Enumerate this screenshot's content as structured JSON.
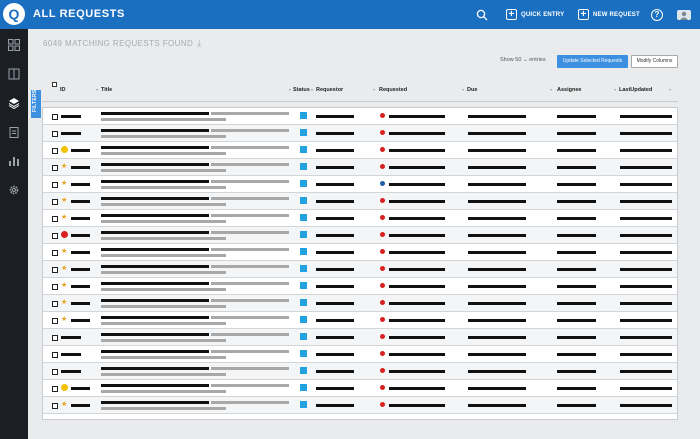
{
  "app": {
    "logo_letter": "Q",
    "title": "ALL REQUESTS"
  },
  "topbar": {
    "quick_entry": "QUICK ENTRY",
    "new_request": "NEW REQUEST"
  },
  "summary": {
    "found": "6049 MATCHING REQUESTS FOUND"
  },
  "controls": {
    "show_label": "Show",
    "show_value": "50",
    "entries_label": "entries",
    "update_button": "Update Selected Requests",
    "modify_button": "Modify Columns"
  },
  "filters_tab": "FILTERS",
  "columns": [
    "ID",
    "Title",
    "Status",
    "Requestor",
    "Requested",
    "Due",
    "Assignee",
    "LastUpdated"
  ],
  "colors": {
    "accent": "#1a6fc0",
    "sidebar": "#1b1f23",
    "status": "#23a2e0",
    "priority_red": "#d92020",
    "priority_yellow": "#f2c200",
    "star": "#e8a020"
  },
  "icons": {
    "search": "search-icon",
    "help": "help-icon",
    "user": "user-avatar-icon"
  },
  "rows": [
    {
      "flag": "none",
      "req_dot": "red"
    },
    {
      "flag": "none",
      "req_dot": "red"
    },
    {
      "flag": "yellow",
      "req_dot": "red"
    },
    {
      "flag": "star",
      "req_dot": "red"
    },
    {
      "flag": "star",
      "req_dot": "blue"
    },
    {
      "flag": "star",
      "req_dot": "red"
    },
    {
      "flag": "star",
      "req_dot": "red"
    },
    {
      "flag": "red",
      "req_dot": "red"
    },
    {
      "flag": "star",
      "req_dot": "red"
    },
    {
      "flag": "star",
      "req_dot": "red"
    },
    {
      "flag": "star",
      "req_dot": "red"
    },
    {
      "flag": "star",
      "req_dot": "red"
    },
    {
      "flag": "star",
      "req_dot": "red"
    },
    {
      "flag": "none",
      "req_dot": "red"
    },
    {
      "flag": "none",
      "req_dot": "red"
    },
    {
      "flag": "none",
      "req_dot": "red"
    },
    {
      "flag": "yellow",
      "req_dot": "red"
    },
    {
      "flag": "star",
      "req_dot": "red"
    }
  ]
}
